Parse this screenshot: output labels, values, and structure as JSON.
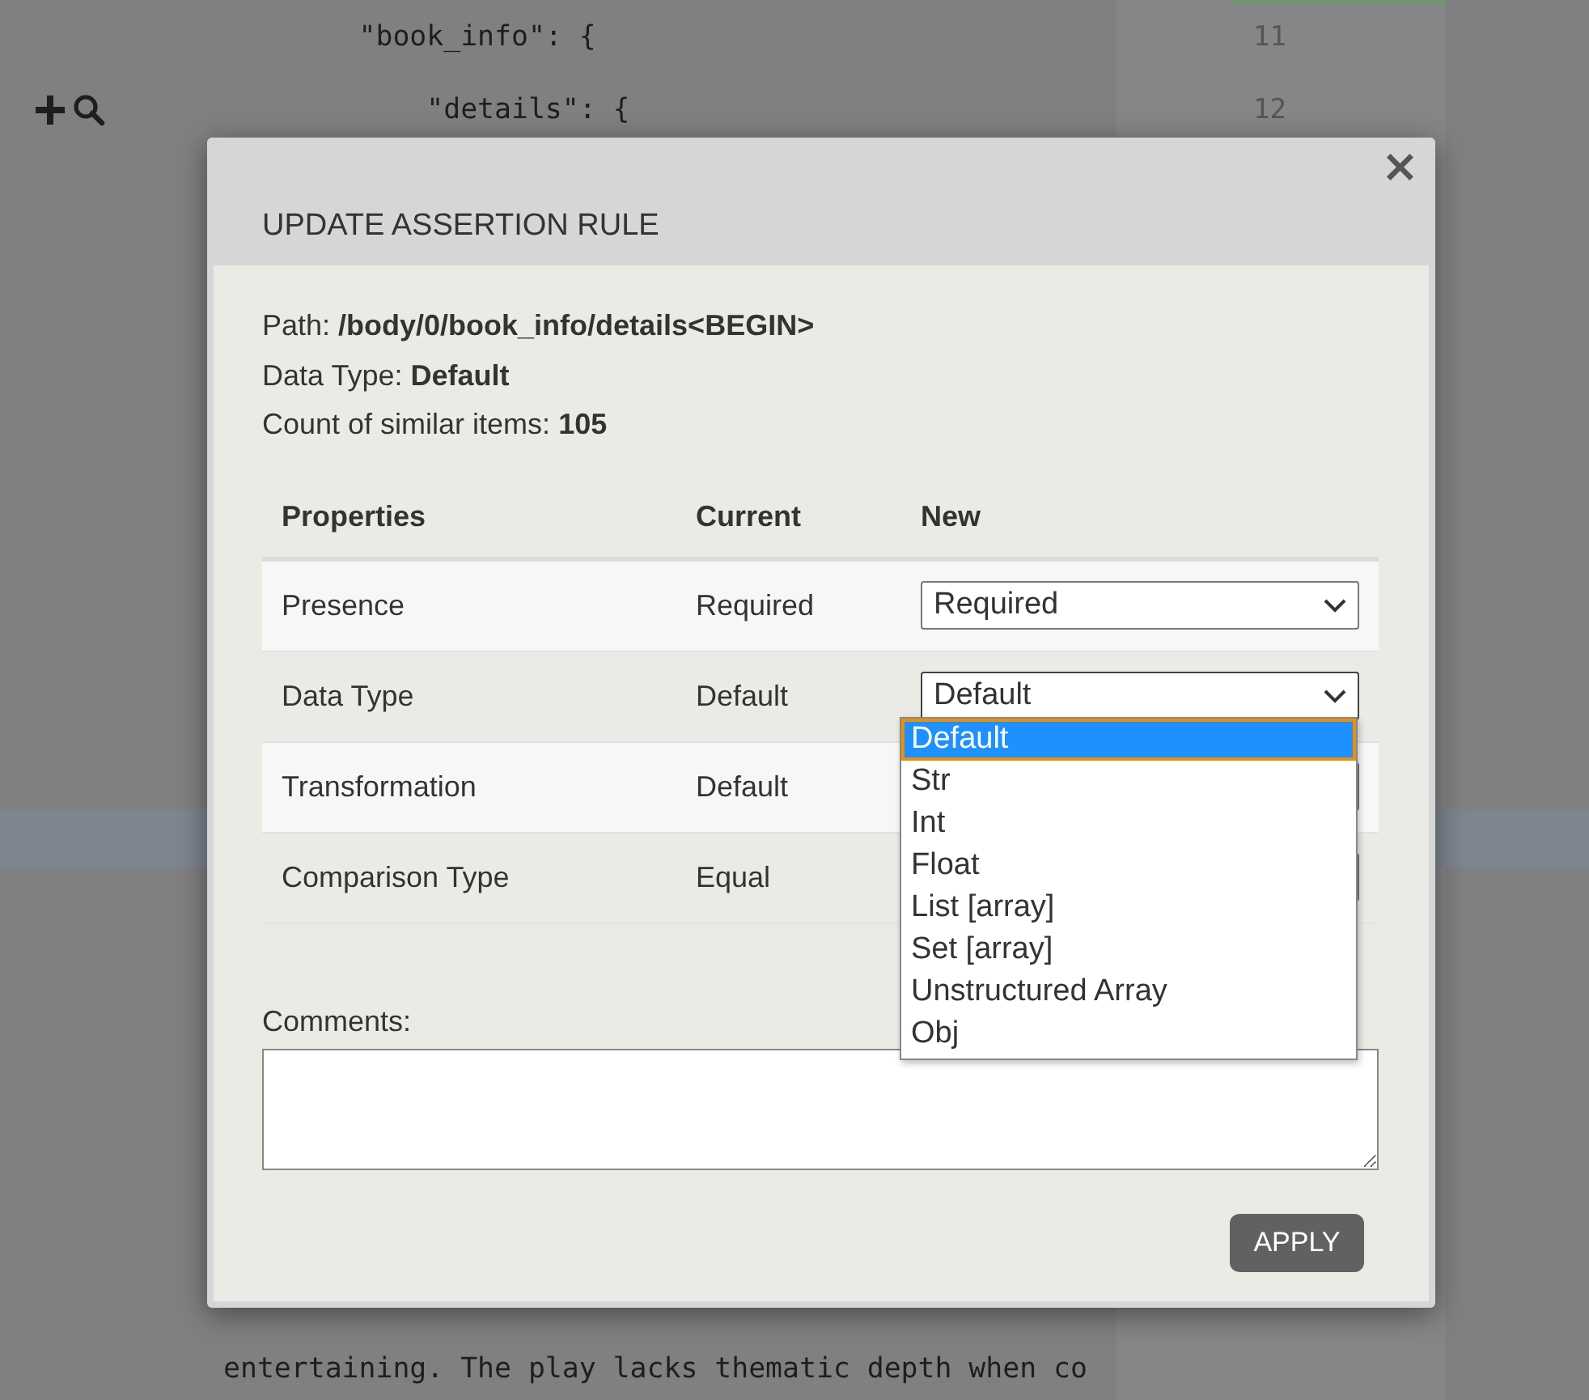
{
  "code_view": {
    "lines": [
      {
        "text": "        \"book_info\": {",
        "number": "11"
      },
      {
        "text": "            \"details\": {",
        "number": "12"
      }
    ],
    "bottom_line": {
      "text": "entertaining. The play lacks thematic depth when co"
    }
  },
  "dialog": {
    "title": "UPDATE ASSERTION RULE",
    "close": "×",
    "info": [
      "Path: **/body/0/book_info/details<BEGIN>**",
      "Data Type: **Default**",
      "Count of similar items: **105**"
    ],
    "columns": [
      "Properties",
      "Current",
      "New"
    ],
    "rows": [
      {
        "property": "Presence",
        "current": "Required",
        "new": "Required",
        "expanded": false
      },
      {
        "property": "Data Type",
        "current": "Default",
        "new": "Default",
        "expanded": true,
        "options": [
          {
            "label": "Default",
            "selected": true
          },
          {
            "label": "Str",
            "selected": false
          },
          {
            "label": "Int",
            "selected": false
          },
          {
            "label": "Float",
            "selected": false
          },
          {
            "label": "List [array]",
            "selected": false
          },
          {
            "label": "Set [array]",
            "selected": false
          },
          {
            "label": "Unstructured Array",
            "selected": false
          },
          {
            "label": "Obj",
            "selected": false
          }
        ]
      },
      {
        "property": "Transformation",
        "current": "Default",
        "expanded": false
      },
      {
        "property": "Comparison Type",
        "current": "Equal",
        "expanded": false
      }
    ],
    "comments_label": "Comments:",
    "apply": "APPLY"
  }
}
